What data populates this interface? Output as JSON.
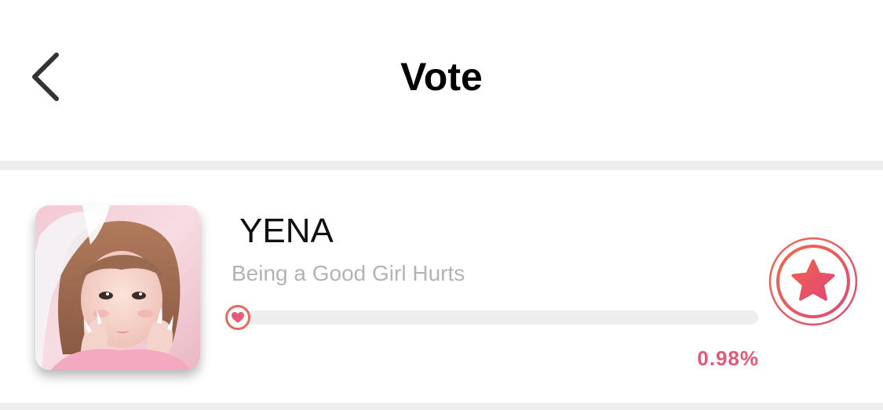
{
  "header": {
    "title": "Vote",
    "back_icon": "chevron-left-icon"
  },
  "vote_item": {
    "artist": "YENA",
    "song": "Being a Good Girl Hurts",
    "percent_label": "0.98%",
    "percent_value": 0.98,
    "knob_icon": "heart-icon",
    "vote_icon": "star-icon"
  },
  "colors": {
    "accent": "#e05a78",
    "accent_orange": "#f06a4a",
    "divider": "#eeeeee",
    "subtitle": "#b3b3b3"
  }
}
